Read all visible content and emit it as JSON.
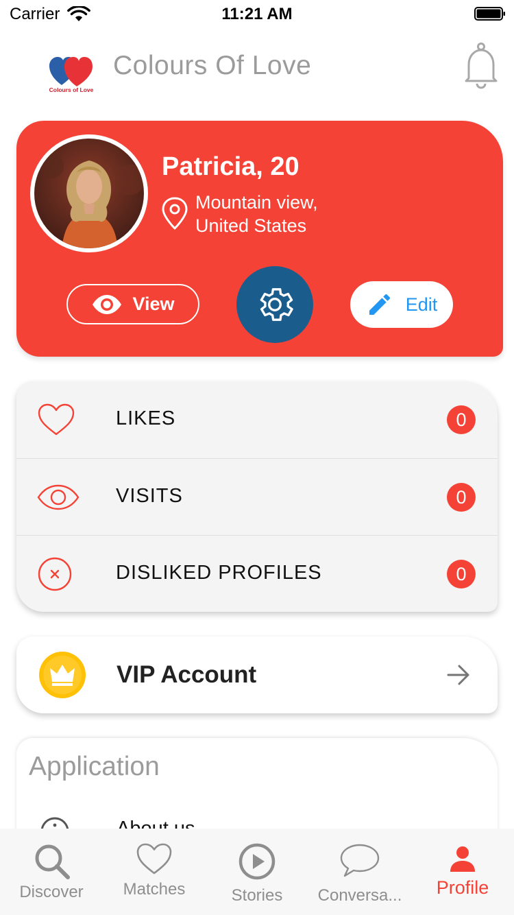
{
  "status_bar": {
    "carrier": "Carrier",
    "time": "11:21 AM"
  },
  "header": {
    "logo_text": "Colours of Love",
    "title": "Colours Of Love"
  },
  "profile": {
    "name": "Patricia, 20",
    "location_line1": "Mountain view,",
    "location_line2": "United States",
    "view_label": "View",
    "edit_label": "Edit"
  },
  "stats": [
    {
      "label": "LIKES",
      "count": "0",
      "icon": "heart-outline-icon"
    },
    {
      "label": "VISITS",
      "count": "0",
      "icon": "eye-outline-icon"
    },
    {
      "label": "DISLIKED PROFILES",
      "count": "0",
      "icon": "x-circle-icon"
    }
  ],
  "vip": {
    "label": "VIP Account"
  },
  "application": {
    "title": "Application",
    "items": [
      {
        "label": "About us",
        "icon": "info-circle-icon"
      }
    ]
  },
  "tabs": [
    {
      "label": "Discover",
      "icon": "search-icon",
      "active": false
    },
    {
      "label": "Matches",
      "icon": "heart-icon",
      "active": false
    },
    {
      "label": "Stories",
      "icon": "play-circle-icon",
      "active": false
    },
    {
      "label": "Conversa...",
      "icon": "chat-bubble-icon",
      "active": false
    },
    {
      "label": "Profile",
      "icon": "person-icon",
      "active": true
    }
  ],
  "colors": {
    "primary_red": "#f44336",
    "settings_blue": "#1a5d8c",
    "edit_blue": "#2196f3",
    "vip_gold": "#ffc107"
  }
}
